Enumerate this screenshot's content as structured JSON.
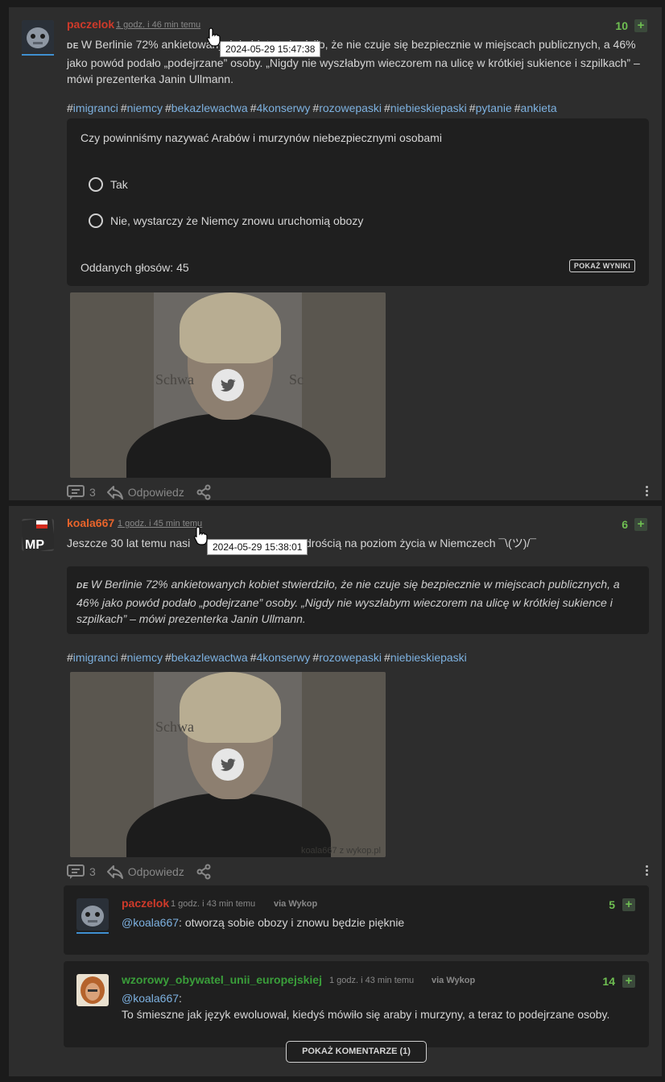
{
  "posts": [
    {
      "author": "paczelok",
      "time": "1 godz. i 46 min temu",
      "tooltip": "2024-05-29 15:47:38",
      "score": "10",
      "plus": "+",
      "lang": "DE",
      "body": "W Berlinie 72% ankietowanych kobiet stwierdziło, że nie czuje się bezpiecznie w miejscach publicznych, a 46% jako powód podało „podejrzane” osoby. „Nigdy nie wyszłabym wieczorem na ulicę w krótkiej sukience i szpilkach” – mówi prezenterka Janin Ullmann.",
      "tags": [
        "imigranci",
        "niemcy",
        "bekazlewactwa",
        "4konserwy",
        "rozowepaski",
        "niebieskiepaski",
        "pytanie",
        "ankieta"
      ],
      "poll": {
        "question": "Czy powinniśmy nazywać Arabów i murzynów niebezpiecznymi osobami",
        "options": [
          "Tak",
          "Nie, wystarczy że Niemcy znowu uruchomią obozy"
        ],
        "votes_label": "Oddanych głosów: 45",
        "results_button": "POKAŻ WYNIKI"
      },
      "comments_count": "3",
      "reply_label": "Odpowiedz"
    },
    {
      "author": "koala667",
      "time": "1 godz. i 45 min temu",
      "tooltip": "2024-05-29 15:38:01",
      "score": "6",
      "plus": "+",
      "body_visible_left": "Jeszcze 30 lat temu nasi",
      "body_visible_right": "drością na poziom życia w Niemczech ¯\\(ツ)/¯",
      "quote_lang": "DE",
      "quote": "W Berlinie 72% ankietowanych kobiet stwierdziło, że nie czuje się bezpiecznie w miejscach publicznych, a 46% jako powód podało „podejrzane” osoby. „Nigdy nie wyszłabym wieczorem na ulicę w krótkiej sukience i szpilkach” – mówi prezenterka Janin Ullmann.",
      "tags": [
        "imigranci",
        "niemcy",
        "bekazlewactwa",
        "4konserwy",
        "rozowepaski",
        "niebieskiepaski"
      ],
      "watermark": "koala667 z wykop.pl",
      "comments_count": "3",
      "reply_label": "Odpowiedz"
    }
  ],
  "embed": {
    "text_left": "Schwa",
    "text_right": "Sc"
  },
  "replies": [
    {
      "author": "paczelok",
      "time": "1 godz. i 43 min temu",
      "via": "via Wykop",
      "score": "5",
      "plus": "+",
      "mention": "@koala667",
      "text": ": otworzą sobie obozy i znowu będzie pięknie"
    },
    {
      "author": "wzorowy_obywatel_unii_europejskiej",
      "time": "1 godz. i 43 min temu",
      "via": "via Wykop",
      "score": "14",
      "plus": "+",
      "mention": "@koala667",
      "text_colon": ":",
      "text": "To śmieszne jak język ewoluował, kiedyś mówiło się araby i murzyny, a teraz to podejrzane osoby."
    }
  ],
  "more_comments": "POKAŻ KOMENTARZE (1)",
  "colors": {
    "accent_green": "#6fbf52",
    "tag_blue": "#7db1e0",
    "author_red": "#cf3a2a",
    "author_orange": "#e8642b",
    "author_green": "#3a9e3a"
  }
}
